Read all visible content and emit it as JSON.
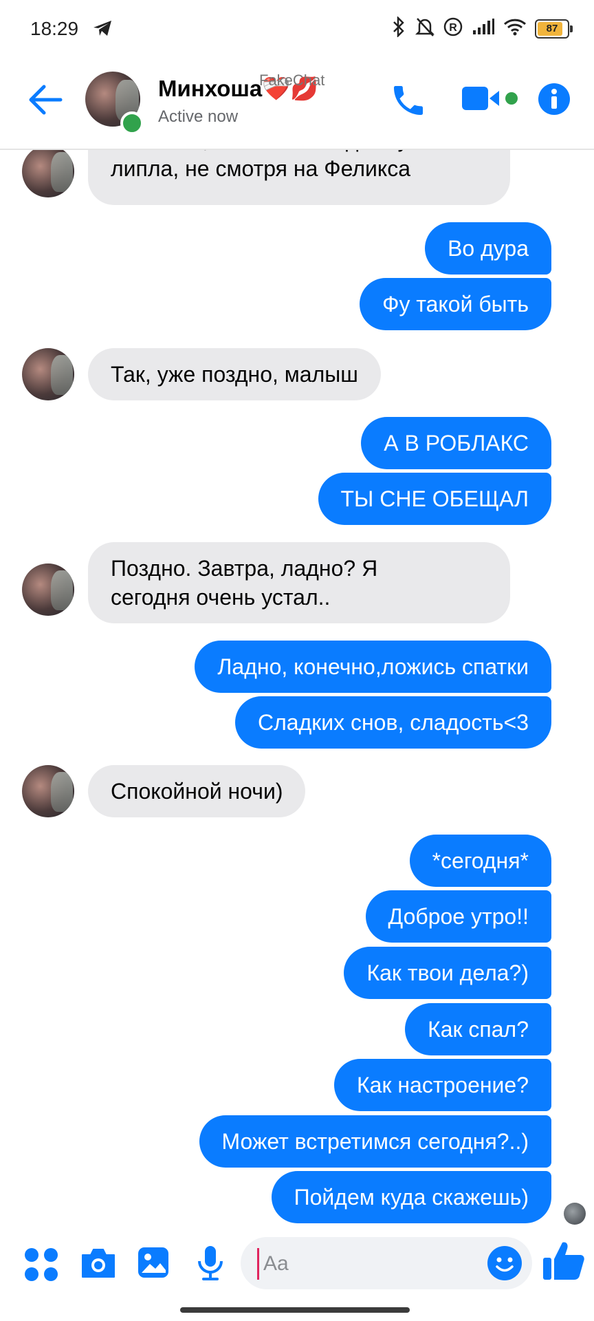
{
  "status_bar": {
    "time": "18:29",
    "battery": "87"
  },
  "header": {
    "name": "Минхоша❤️‍🩹💋",
    "status": "Active now",
    "watermark": "FakeChat"
  },
  "messages": [
    {
      "dir": "in",
      "lines": [
        "счет того,что она к Хенджину",
        "липла, не смотря на Феликса"
      ]
    },
    {
      "dir": "out",
      "lines": [
        "Во дура"
      ]
    },
    {
      "dir": "out",
      "lines": [
        "Фу такой быть"
      ]
    },
    {
      "dir": "in",
      "lines": [
        "Так, уже поздно, малыш"
      ]
    },
    {
      "dir": "out",
      "lines": [
        "А В РОБЛАКС"
      ]
    },
    {
      "dir": "out",
      "lines": [
        "ТЫ СНЕ ОБЕЩАЛ"
      ]
    },
    {
      "dir": "in",
      "lines": [
        "Поздно. Завтра, ладно? Я",
        "сегодня очень устал.."
      ]
    },
    {
      "dir": "out",
      "lines": [
        "Ладно, конечно,ложись спатки"
      ]
    },
    {
      "dir": "out",
      "lines": [
        "Сладких снов, сладость<3"
      ]
    },
    {
      "dir": "in",
      "lines": [
        "Спокойной ночи)"
      ]
    },
    {
      "dir": "out",
      "lines": [
        "*сегодня*"
      ]
    },
    {
      "dir": "out",
      "lines": [
        "Доброе утро!!"
      ]
    },
    {
      "dir": "out",
      "lines": [
        "Как твои дела?)"
      ]
    },
    {
      "dir": "out",
      "lines": [
        "Как спал?"
      ]
    },
    {
      "dir": "out",
      "lines": [
        "Как настроение?"
      ]
    },
    {
      "dir": "out",
      "lines": [
        "Может встретимся сегодня?..)"
      ]
    },
    {
      "dir": "out",
      "lines": [
        "Пойдем куда скажешь)"
      ]
    }
  ],
  "composer": {
    "placeholder": "Aa"
  },
  "colors": {
    "accent": "#0a7cff",
    "incoming": "#e9e9eb",
    "online": "#31a24c"
  }
}
